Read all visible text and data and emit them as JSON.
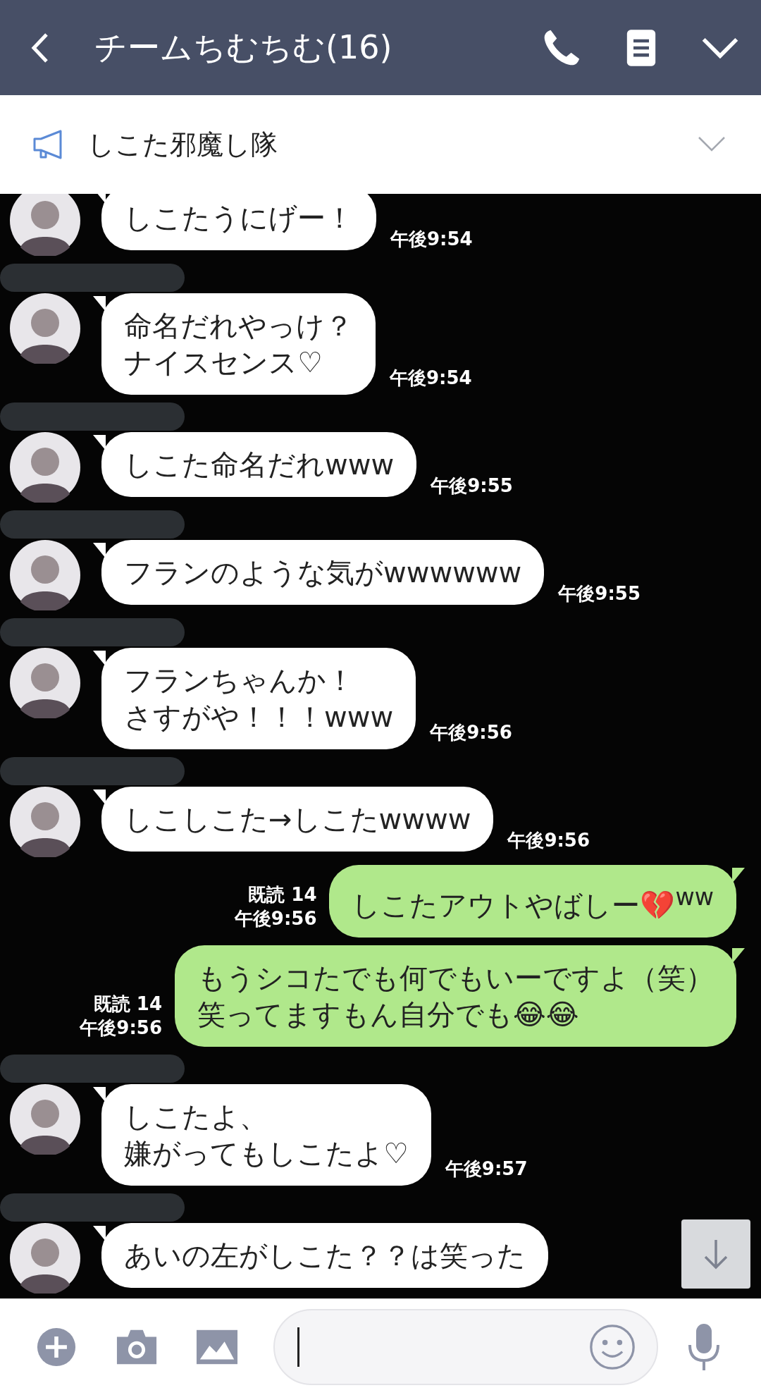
{
  "header": {
    "title": "チームちむちむ(16)"
  },
  "announcement": {
    "text": "しこた邪魔し隊"
  },
  "messages": [
    {
      "kind": "incoming",
      "lines": [
        "しこたうにげー！"
      ],
      "time": "午後9:54"
    },
    {
      "kind": "incoming",
      "lines": [
        "命名だれやっけ？",
        "ナイスセンス♡"
      ],
      "time": "午後9:54"
    },
    {
      "kind": "incoming",
      "lines": [
        "しこた命名だれwww"
      ],
      "time": "午後9:55"
    },
    {
      "kind": "incoming",
      "lines": [
        "フランのような気がwwwwww"
      ],
      "time": "午後9:55"
    },
    {
      "kind": "incoming",
      "lines": [
        "フランちゃんか！",
        "さすがや！！！www"
      ],
      "time": "午後9:56"
    },
    {
      "kind": "incoming",
      "lines": [
        "しこしこた→しこたwwww"
      ],
      "time": "午後9:56"
    },
    {
      "kind": "outgoing",
      "lines": [
        "しこたアウトやばしー💔$^{ww}$"
      ],
      "read": "既読 14",
      "time": "午後9:56"
    },
    {
      "kind": "outgoing",
      "lines": [
        "もうシコたでも何でもいーですよ（笑）",
        "笑ってますもん自分でも😂😂"
      ],
      "read": "既読 14",
      "time": "午後9:56"
    },
    {
      "kind": "incoming",
      "lines": [
        "しこたよ、",
        "嫌がってもしこたよ♡"
      ],
      "time": "午後9:57"
    },
    {
      "kind": "incoming",
      "lines": [
        "あいの左がしこた？？は笑った"
      ]
    }
  ]
}
